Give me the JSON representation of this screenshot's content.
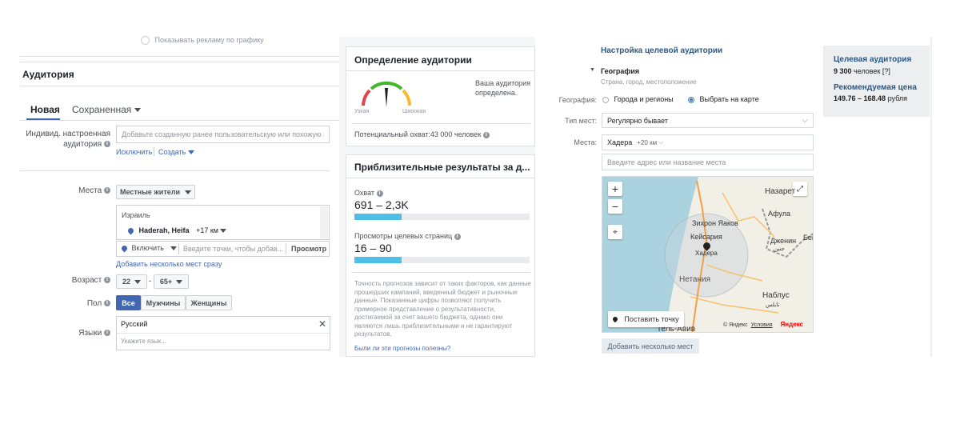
{
  "fb": {
    "top_hint": "Показывать рекламу по графику",
    "audience_title": "Аудитория",
    "tabs": {
      "new": "Новая",
      "saved": "Сохраненная"
    },
    "custom_audience": {
      "label": "Индивид. настроенная аудитория",
      "placeholder": "Добавьте созданную ранее пользовательскую или похожую аудит",
      "exclude": "Исключить",
      "create": "Создать"
    },
    "places": {
      "label": "Места",
      "mode": "Местные жители",
      "country": "Израиль",
      "city": "Haderah, Heifa",
      "radius": "+17 км",
      "include": "Включить",
      "search_placeholder": "Введите точки, чтобы добав...",
      "browse": "Просмотр",
      "add_multiple": "Добавить несколько мест сразу"
    },
    "age": {
      "label": "Возраст",
      "from": "22",
      "sep": "-",
      "to": "65+"
    },
    "gender": {
      "label": "Пол",
      "options": [
        "Все",
        "Мужчины",
        "Женщины"
      ]
    },
    "languages": {
      "label": "Языки",
      "value": "Русский",
      "placeholder": "Укажите язык..."
    },
    "definition": {
      "title": "Определение аудитории",
      "narrow": "Узкая",
      "wide": "Шиоокая",
      "status": "Ваша аудитория определена.",
      "potential": "Потенциальный охват:43 000 человек"
    },
    "estimates": {
      "title": "Приблизительные результаты за д...",
      "reach_label": "Охват",
      "reach_value": "691 – 2,3K",
      "reach_fill": 0.27,
      "views_label": "Просмотры целевых страниц",
      "views_value": "16 – 90",
      "views_fill": 0.27,
      "disclaimer": "Точность прогнозов зависит от таких факторов, как данные прошедших кампаний, введенный бюджет и рыночные данные. Показанные цифры позволяют получить примерное представление о результативности, достигаемой за счет вашего бюджета, однако они являются лишь приблизительными и не гарантируют результатов.",
      "feedback": "Были ли эти прогнозы полезны?"
    }
  },
  "vk": {
    "title": "Настройка целевой аудитории",
    "geo_title": "География",
    "geo_sub": "Страна, город, местоположение",
    "geo_label": "География:",
    "radio_cities": "Города и регионы",
    "radio_map": "Выбрать на карте",
    "place_type_label": "Тип мест:",
    "place_type_value": "Регулярно бывает",
    "places_label": "Места:",
    "place_tag": "Хадера",
    "place_radius": "+20 км",
    "address_placeholder": "Введите адрес или название места",
    "map_labels": {
      "nazareth": "Назарет",
      "afula": "Афула",
      "zikhron": "Зихрон Яаков",
      "caesarea": "Кейсария",
      "hadera": "Хадера",
      "jenin": "Дженин",
      "jenin_ar": "جنين",
      "netanya": "Нетания",
      "nablus": "Наблус",
      "nablus_ar": "نابلس",
      "telaviv": "Тель-Авив",
      "bei": "Бей"
    },
    "set_point": "Поставить точку",
    "copyright": "© Яндекс",
    "terms": "Условия",
    "yandex": "Яндекс",
    "add_places": "Добавить несколько мест",
    "target_label": "Целевая аудитория",
    "target_value": "9 300",
    "target_unit": "человек [?]",
    "price_label": "Рекомендуемая цена",
    "price_value": "149.76 – 168.48",
    "price_unit": "рубля"
  }
}
